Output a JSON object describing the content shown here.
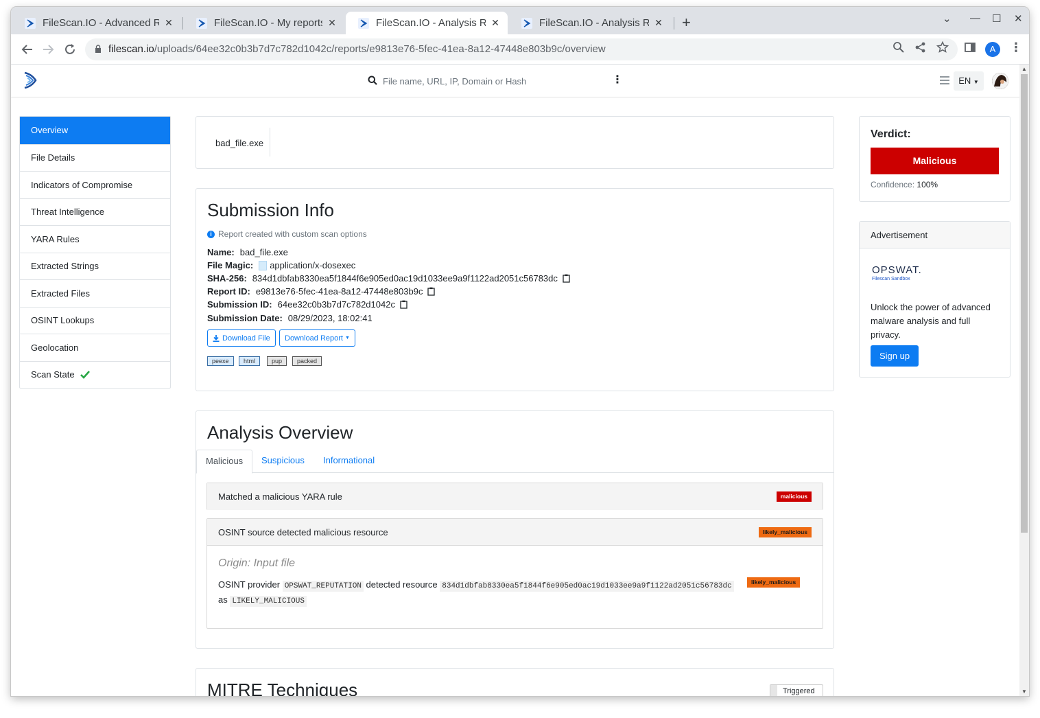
{
  "browser": {
    "tabs": [
      {
        "title": "FileScan.IO - Advanced Re",
        "active": false
      },
      {
        "title": "FileScan.IO - My reports",
        "active": false
      },
      {
        "title": "FileScan.IO - Analysis Rep",
        "active": true
      },
      {
        "title": "FileScan.IO - Analysis Rep",
        "active": false
      }
    ],
    "url_host": "filescan.io",
    "url_path": "/uploads/64ee32c0b3b7d7c782d1042c/reports/e9813e76-5fec-41ea-8a12-47448e803b9c/overview",
    "profile_initial": "A"
  },
  "header": {
    "search_placeholder": "File name, URL, IP, Domain or Hash",
    "language": "EN"
  },
  "sidebar": {
    "items": [
      {
        "label": "Overview",
        "active": true
      },
      {
        "label": "File Details"
      },
      {
        "label": "Indicators of Compromise"
      },
      {
        "label": "Threat Intelligence"
      },
      {
        "label": "YARA Rules"
      },
      {
        "label": "Extracted Strings"
      },
      {
        "label": "Extracted Files"
      },
      {
        "label": "OSINT Lookups"
      },
      {
        "label": "Geolocation"
      },
      {
        "label": "Scan State",
        "icon": "check-icon"
      }
    ]
  },
  "file": {
    "name": "bad_file.exe"
  },
  "submission": {
    "title": "Submission Info",
    "note": "Report created with custom scan options",
    "name_label": "Name:",
    "name": "bad_file.exe",
    "magic_label": "File Magic:",
    "magic": "application/x-dosexec",
    "sha_label": "SHA-256:",
    "sha256": "834d1dbfab8330ea5f1844f6e905ed0ac19d1033ee9a9f1122ad2051c56783dc",
    "report_label": "Report ID:",
    "report_id": "e9813e76-5fec-41ea-8a12-47448e803b9c",
    "subid_label": "Submission ID:",
    "submission_id": "64ee32c0b3b7d7c782d1042c",
    "date_label": "Submission Date:",
    "date": "08/29/2023, 18:02:41",
    "download_file": "Download File",
    "download_report": "Download Report",
    "tags": [
      "peexe",
      "html",
      "pup",
      "packed"
    ]
  },
  "analysis": {
    "title": "Analysis Overview",
    "tabs": [
      "Malicious",
      "Suspicious",
      "Informational"
    ],
    "findings": [
      {
        "title": "Matched a malicious YARA rule",
        "badge": "malicious"
      },
      {
        "title": "OSINT source detected malicious resource",
        "badge": "likely_malicious",
        "origin": "Origin: Input file",
        "text_1": "OSINT provider",
        "provider": "OPSWAT_REPUTATION",
        "text_2": "detected resource",
        "resource": "834d1dbfab8330ea5f1844f6e905ed0ac19d1033ee9a9f1122ad2051c56783dc",
        "text_3": "as",
        "verdict": "LIKELY_MALICIOUS",
        "inner_badge": "likely_malicious"
      }
    ]
  },
  "mitre": {
    "title": "MITRE Techniques",
    "toggle": "Triggered"
  },
  "verdict": {
    "label": "Verdict:",
    "value": "Malicious",
    "confidence_label": "Confidence:",
    "confidence": "100%",
    "color": "#cc0000"
  },
  "ad": {
    "title": "Advertisement",
    "brand": "OPSWAT.",
    "brand_sub": "Filescan Sandbox",
    "text": "Unlock the power of advanced malware analysis and full privacy.",
    "cta": "Sign up"
  },
  "colors": {
    "accent": "#0d7cf2",
    "malicious": "#cc0000",
    "likely_malicious": "#ee6a12",
    "success": "#28a745"
  }
}
